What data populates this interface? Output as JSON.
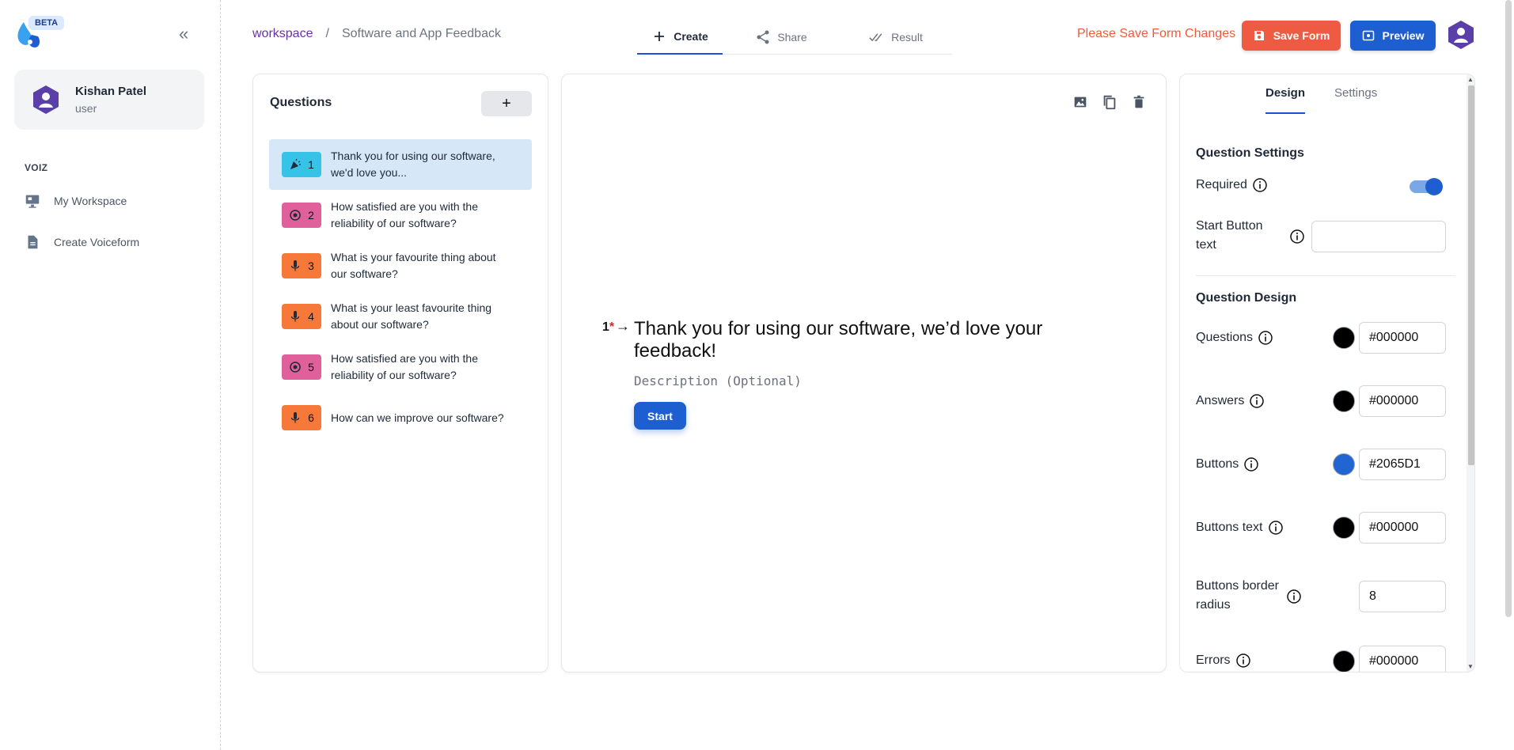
{
  "sidebar": {
    "beta": "BETA",
    "user": {
      "name": "Kishan Patel",
      "role": "user"
    },
    "section": "VOIZ",
    "items": [
      {
        "label": "My Workspace",
        "icon": "monitor-icon"
      },
      {
        "label": "Create Voiceform",
        "icon": "document-icon"
      }
    ]
  },
  "header": {
    "breadcrumb": {
      "root": "workspace",
      "separator": "/",
      "current": "Software and App Feedback"
    },
    "tabs": [
      {
        "label": "Create",
        "active": true
      },
      {
        "label": "Share",
        "active": false
      },
      {
        "label": "Result",
        "active": false
      }
    ],
    "save_message": "Please Save Form Changes",
    "save_label": "Save Form",
    "preview_label": "Preview"
  },
  "questions": {
    "title": "Questions",
    "add_label": "+",
    "items": [
      {
        "number": "1",
        "text": "Thank you for using our software, we'd love you...",
        "type": "welcome",
        "color": "#37c2e8"
      },
      {
        "number": "2",
        "text": "How satisfied are you with the reliability of our software?",
        "type": "rating",
        "color": "#e0609c"
      },
      {
        "number": "3",
        "text": "What is your favourite thing about our software?",
        "type": "voice",
        "color": "#f7793a"
      },
      {
        "number": "4",
        "text": "What is your least favourite thing about our software?",
        "type": "voice",
        "color": "#f7793a"
      },
      {
        "number": "5",
        "text": "How satisfied are you with the reliability of our software?",
        "type": "rating",
        "color": "#e0609c"
      },
      {
        "number": "6",
        "text": "How can we improve our software?",
        "type": "voice",
        "color": "#f7793a"
      }
    ]
  },
  "canvas": {
    "number": "1",
    "required_mark": "*",
    "arrow": "→",
    "question": "Thank you for using our software, we’d love your feedback!",
    "description_placeholder": "Description (Optional)",
    "start_label": "Start"
  },
  "design": {
    "tabs": [
      "Design",
      "Settings"
    ],
    "question_settings_title": "Question Settings",
    "required_label": "Required",
    "required_on": true,
    "start_button_text_label": "Start Button text",
    "start_button_text_value": "",
    "question_design_title": "Question Design",
    "colors": [
      {
        "label": "Questions",
        "value": "#000000"
      },
      {
        "label": "Answers",
        "value": "#000000"
      },
      {
        "label": "Buttons",
        "value": "#2065D1"
      },
      {
        "label": "Buttons text",
        "value": "#000000"
      }
    ],
    "border_radius_label": "Buttons border radius",
    "border_radius_value": "8",
    "errors_label": "Errors",
    "errors_value": "#000000"
  }
}
